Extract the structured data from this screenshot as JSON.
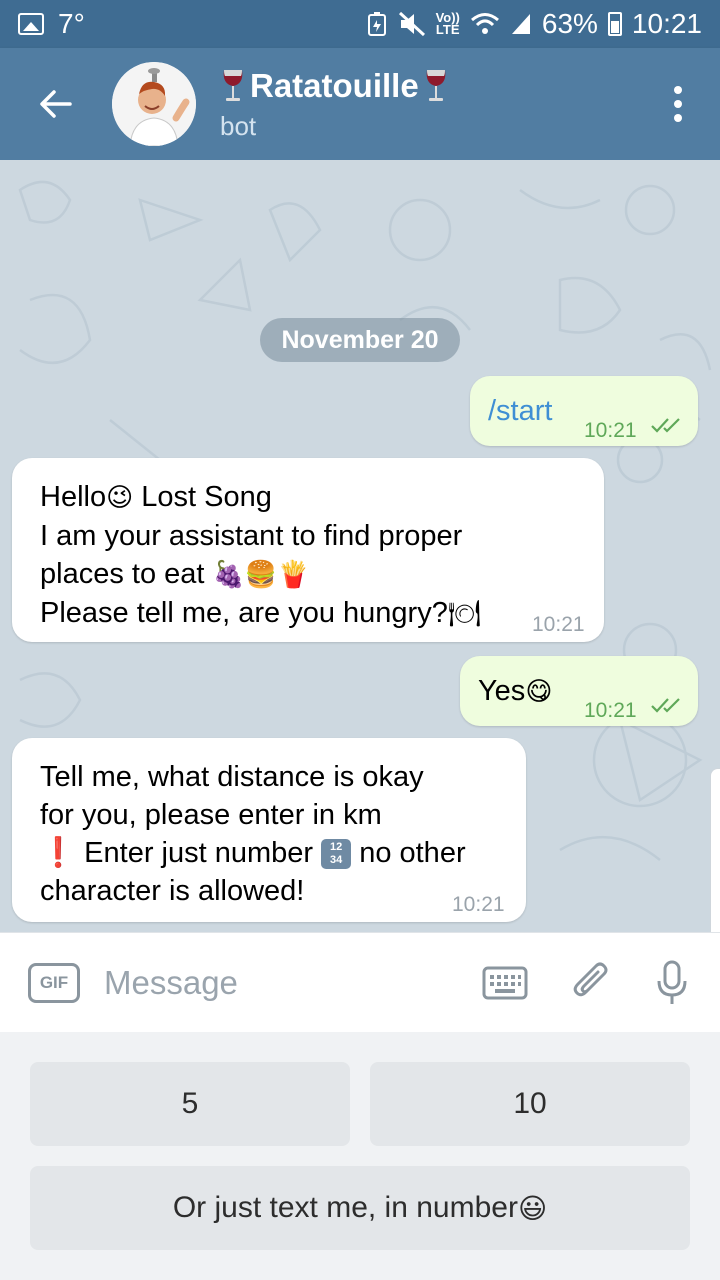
{
  "status_bar": {
    "temperature": "7°",
    "network": "Vo)) LTE",
    "battery": "63%",
    "time": "10:21"
  },
  "header": {
    "title": "Ratatouille",
    "subtitle": "bot",
    "title_decoration_icon": "wine-glass-icon"
  },
  "chat": {
    "date_separator": "November 20",
    "messages": [
      {
        "direction": "out",
        "text": "/start",
        "time": "10:21",
        "status": "read"
      },
      {
        "direction": "in",
        "lines": [
          "Hello",
          "Lost Song",
          "I am your assistant to find proper",
          "places to eat",
          "Please tell me, are you hungry?"
        ],
        "time": "10:21"
      },
      {
        "direction": "out",
        "text": "Yes",
        "time": "10:21",
        "status": "read"
      },
      {
        "direction": "in",
        "lines": [
          "Tell me, what distance is okay",
          "for you, please enter in km",
          "Enter just number",
          "no other",
          "character is allowed!"
        ],
        "time": "10:21"
      }
    ]
  },
  "input": {
    "gif_label": "GIF",
    "placeholder": "Message"
  },
  "keyboard": {
    "buttons": [
      "5",
      "10",
      "Or just text me, in number"
    ]
  },
  "colors": {
    "status_bar": "#3f6c92",
    "header": "#517da2",
    "outgoing_bubble": "#effdde",
    "incoming_bubble": "#ffffff",
    "time_out": "#5fa859",
    "link": "#3f8fd4"
  }
}
